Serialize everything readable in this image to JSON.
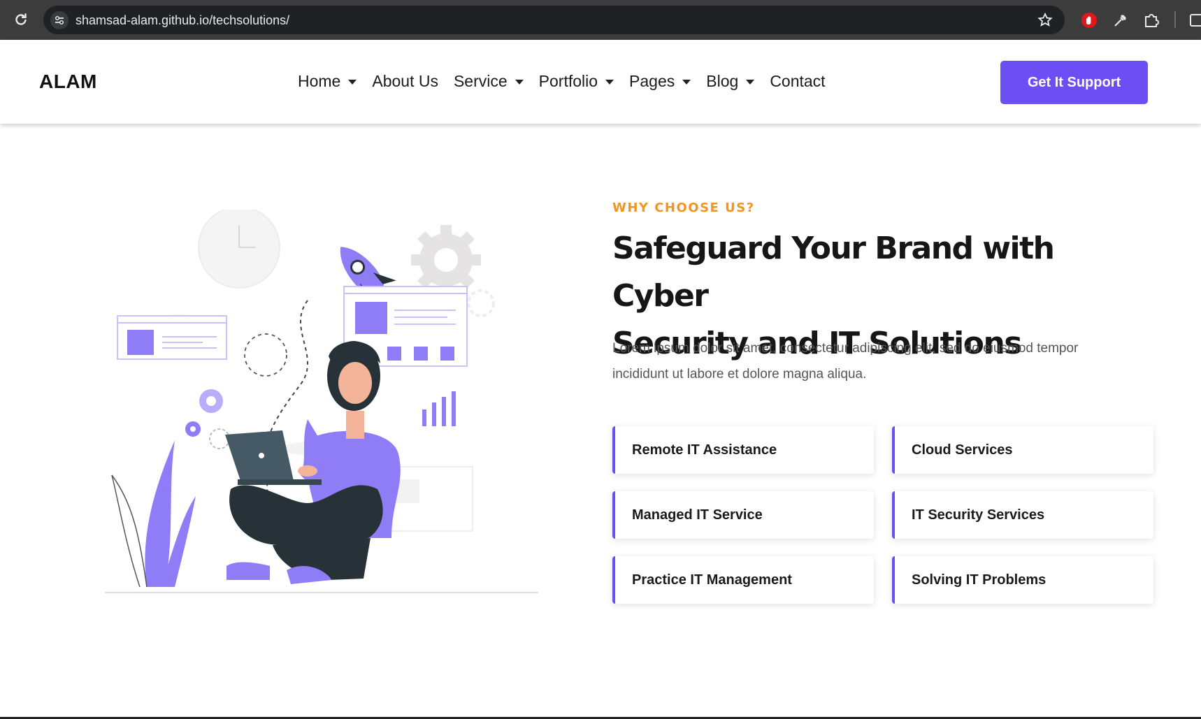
{
  "browser": {
    "url": "shamsad-alam.github.io/techsolutions/"
  },
  "navbar": {
    "logo": "ALAM",
    "items": [
      {
        "label": "Home",
        "dropdown": true
      },
      {
        "label": "About Us",
        "dropdown": false
      },
      {
        "label": "Service",
        "dropdown": true
      },
      {
        "label": "Portfolio",
        "dropdown": true
      },
      {
        "label": "Pages",
        "dropdown": true
      },
      {
        "label": "Blog",
        "dropdown": true
      },
      {
        "label": "Contact",
        "dropdown": false
      }
    ],
    "cta_label": "Get It Support"
  },
  "section": {
    "eyebrow": "WHY CHOOSE US?",
    "heading_line1": "Safeguard Your Brand with Cyber",
    "heading_line2": "Security and IT Solutions",
    "description": "Lorem ipsum dolor sit amet, consectetur adipiscing elit, sed do eiusmod tempor incididunt ut labore et dolore magna aliqua.",
    "services": [
      "Remote IT Assistance",
      "Cloud Services",
      "Managed IT Service",
      "IT Security Services",
      "Practice IT Management",
      "Solving IT Problems"
    ]
  },
  "colors": {
    "accent": "#6c4ef5",
    "illustration_purple": "#8f7cf7",
    "eyebrow": "#f7941d",
    "heading": "#161616",
    "browser_bar": "#3c3c3c"
  }
}
